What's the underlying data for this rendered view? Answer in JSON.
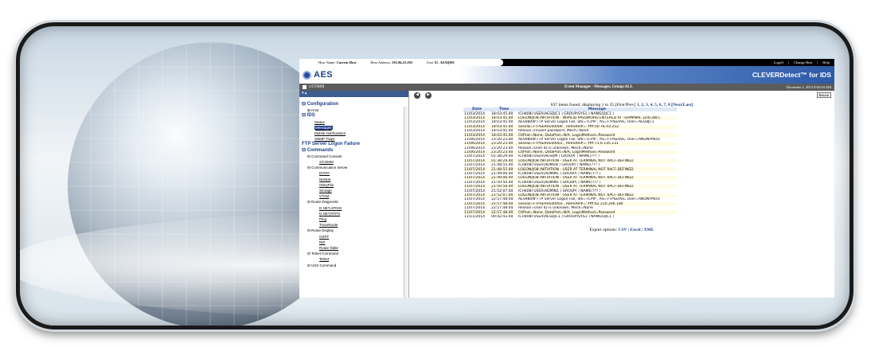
{
  "topbar": {
    "host_name_label": "Host Name:",
    "host_name": "Current Host",
    "host_address_label": "Host Address:",
    "host_address": "192.86.33.190",
    "user_id_label": "User ID:",
    "user_id": "AESQMS",
    "logoff": "Logoff",
    "change_host": "Change Host",
    "help": "Help",
    "sep": "|"
  },
  "header": {
    "logo": "AES",
    "brand": "CLEVERDetect™ for IDS"
  },
  "titlebar": {
    "system": "z/COMM",
    "title": "Event Manager - Messages, Group:ALL",
    "date": "December 1, 2014 9:02:04 AM"
  },
  "sidebar": {
    "collapse": "▾ ▴",
    "items": [
      {
        "label": "⊟ Configuration",
        "cls": "cat"
      },
      {
        "label": "⊞ Host",
        "cls": "l1"
      },
      {
        "label": "⊟ IDS",
        "cls": "cat"
      },
      {
        "label": "Status",
        "cls": "l2 lnk"
      },
      {
        "label": "Messages",
        "cls": "l2 lnk sel"
      },
      {
        "label": "Mobile Notifications",
        "cls": "l2 lnk"
      },
      {
        "label": "SNMP Traps",
        "cls": "l2 lnk"
      },
      {
        "label": "FTP Server Logon Failure",
        "cls": "cat"
      },
      {
        "label": "⊟ Commands",
        "cls": "cat"
      },
      {
        "label": "⊟ Command Console",
        "cls": "l1"
      },
      {
        "label": "z/COMM",
        "cls": "l3 lnk"
      },
      {
        "label": "⊟ Communication Server",
        "cls": "l1"
      },
      {
        "label": "DVIPA",
        "cls": "l3 lnk"
      },
      {
        "label": "Netstat",
        "cls": "l3 lnk"
      },
      {
        "label": "ObeyFile",
        "cls": "l3 lnk"
      },
      {
        "label": "Storage",
        "cls": "l3 lnk"
      },
      {
        "label": "VTAM",
        "cls": "l3 lnk"
      },
      {
        "label": "⊟ Route Diagnostic",
        "cls": "l1"
      },
      {
        "label": "D NET,APING",
        "cls": "l3 lnk"
      },
      {
        "label": "D NET,RTPS",
        "cls": "l3 lnk"
      },
      {
        "label": "Ping",
        "cls": "l3 lnk"
      },
      {
        "label": "TraceRoute",
        "cls": "l3 lnk"
      },
      {
        "label": "⊟ Route Display",
        "cls": "l1"
      },
      {
        "label": "OSPF",
        "cls": "l3 lnk"
      },
      {
        "label": "RIP",
        "cls": "l3 lnk"
      },
      {
        "label": "Route Table",
        "cls": "l3 lnk"
      },
      {
        "label": "⊟ Telnet Command",
        "cls": "l1"
      },
      {
        "label": "Telnet",
        "cls": "l3 lnk"
      },
      {
        "label": "⊟ USS Command",
        "cls": "l1"
      }
    ]
  },
  "main": {
    "back": "◀",
    "forward": "▶",
    "refresh": "Refresh",
    "summary_prefix": "837 items found, displaying 1 to 25.[First/Prev]",
    "pages": "1, 2, 3, 4, 5, 6, 7, 8 [Next/Last]",
    "columns": [
      "Date",
      "Time",
      "Message"
    ],
    "rows": [
      [
        "11/03/2014",
        "18:03:45.00",
        "ICH408I USER(AESDJC1 ) GROUP(SYS1 ) NAME(DJC1 )"
      ],
      [
        "11/03/2014",
        "18:03:45.00",
        "LOGON/JOB INITIATION - INVALID PASSWORD ENTERED AT TERMINAL 324F2BFC"
      ],
      [
        "11/03/2014",
        "18:03:45.00",
        "AES980W FTP Server Logon Fail, Stk=TCPIP , AS=FTPSERVE, User=AESDJC1"
      ],
      [
        "11/03/2014",
        "18:03:45.00",
        "SessID=FTPSERVE00000 , RemoteIP=::ffff:50.78.43.252"
      ],
      [
        "11/03/2014",
        "18:03:45.00",
        "Reason=Invalid password, Mech=None"
      ],
      [
        "11/03/2014",
        "18:03:45.00",
        "CtlProt=None, DataProt=N/A, LoginMethod=Password"
      ],
      [
        "11/06/2014",
        "23:20:23.00",
        "AES980W FTP Server Logon Fail, Stk=TCPIP , AS=FTPSERVE, User=ANONYMOU"
      ],
      [
        "11/06/2014",
        "23:20:23.00",
        "SessID=FTPSERVE00001 , RemoteIP=::ffff:71.6.135.131"
      ],
      [
        "11/06/2014",
        "23:20:23.00",
        "Reason=User ID is unknown, Mech=None"
      ],
      [
        "11/06/2014",
        "23:20:23.00",
        "CtlProt=None, DataProt=N/A, LoginMethod=Password"
      ],
      [
        "11/07/2014",
        "01:38:29.00",
        "ICH408I USER(AESQM ) GROUP( ) NAME(??? )"
      ],
      [
        "11/07/2014",
        "01:38:29.00",
        "LOGON/JOB INITIATION - USER AT TERMINAL NOT RACF-DEFINED"
      ],
      [
        "11/07/2014",
        "21:48:55.00",
        "ICH408I USER(ADMEN ) GROUP( ) NAME(??? )"
      ],
      [
        "11/07/2014",
        "21:48:55.00",
        "LOGON/JOB INITIATION - USER AT TERMINAL NOT RACF-DEFINED"
      ],
      [
        "11/07/2014",
        "21:49:06.00",
        "ICH408I USER(ADMIN1 ) GROUP( ) NAME(??? )"
      ],
      [
        "11/07/2014",
        "21:49:06.00",
        "LOGON/JOB INITIATION - USER AT TERMINAL NOT RACF-DEFINED"
      ],
      [
        "11/07/2014",
        "21:50:50.00",
        "ICH408I USER(ADMIN1 ) GROUP( ) NAME(??? )"
      ],
      [
        "11/07/2014",
        "21:50:50.00",
        "LOGON/JOB INITIATION - USER AT TERMINAL NOT RACF-DEFINED"
      ],
      [
        "11/07/2014",
        "21:52:07.00",
        "ICH408I USER(ADMIN1 ) GROUP( ) NAME(??? )"
      ],
      [
        "11/07/2014",
        "21:52:07.00",
        "LOGON/JOB INITIATION - USER AT TERMINAL NOT RACF-DEFINED"
      ],
      [
        "11/07/2014",
        "22:57:48.00",
        "AES980W FTP Server Logon Fail, Stk=TCPIP , AS=FTPSERVE, User=ANONYMOU"
      ],
      [
        "11/07/2014",
        "22:57:48.00",
        "SessID=FTPSERVE00003 , RemoteIP=::ffff:62.210.206.180"
      ],
      [
        "11/07/2014",
        "22:57:48.00",
        "Reason=User ID is unknown, Mech=None"
      ],
      [
        "11/07/2014",
        "22:57:48.00",
        "CtlProt=None, DataProt=N/A, LoginMethod=Password"
      ],
      [
        "11/11/2014",
        "00:42:43.00",
        "ICH408I USER(AESDJC1 ) GROUP(SYS1 ) NAME(DJC1 )"
      ]
    ],
    "export_label": "Export options:",
    "export_links": "CSV | Excel | XML"
  }
}
